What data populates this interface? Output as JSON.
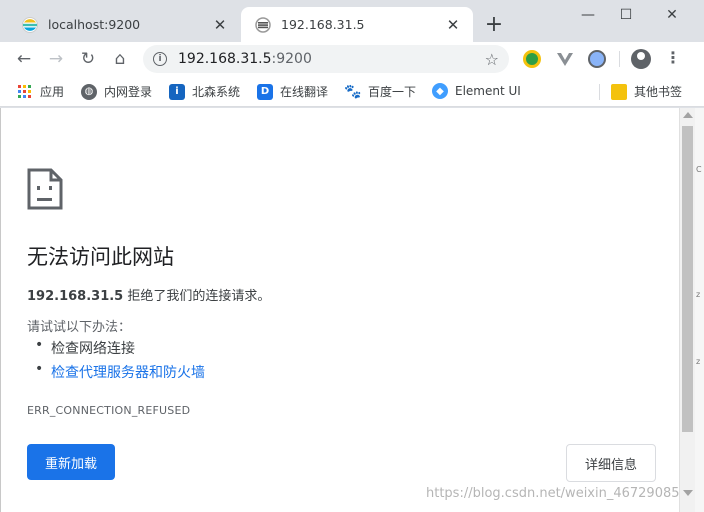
{
  "tabs": [
    {
      "title": "localhost:9200",
      "active": false
    },
    {
      "title": "192.168.31.5",
      "active": true
    }
  ],
  "window_controls": {
    "minimize": "—",
    "maximize": "☐",
    "close": "✕"
  },
  "toolbar": {
    "back": "←",
    "forward": "→",
    "reload": "↻",
    "home": "⌂",
    "omnibox_host": "192.168.31.5",
    "omnibox_port": ":9200",
    "star": "☆",
    "menu": "⋮"
  },
  "bookmarks": [
    {
      "label": "应用",
      "icon": "apps-grid-icon"
    },
    {
      "label": "内网登录",
      "icon": "globe-icon"
    },
    {
      "label": "北森系统",
      "icon": "info-icon"
    },
    {
      "label": "在线翻译",
      "icon": "translate-icon"
    },
    {
      "label": "百度一下",
      "icon": "baidu-paw-icon"
    },
    {
      "label": "Element UI",
      "icon": "element-ui-icon"
    }
  ],
  "other_bookmarks": "其他书签",
  "error_page": {
    "heading": "无法访问此网站",
    "host": "192.168.31.5",
    "summary_rest": " 拒绝了我们的连接请求。",
    "suggestions_header": "请试试以下办法：",
    "suggestions": [
      "检查网络连接",
      "检查代理服务器和防火墙"
    ],
    "error_code": "ERR_CONNECTION_REFUSED",
    "reload_button": "重新加载",
    "details_button": "详细信息"
  },
  "background_chars": [
    "C",
    "z",
    "z"
  ],
  "watermark": "https://blog.csdn.net/weixin_46729085",
  "colors": {
    "accent": "#1a73e8",
    "tab_strip": "#dee1e6",
    "link": "#1a73e8"
  }
}
